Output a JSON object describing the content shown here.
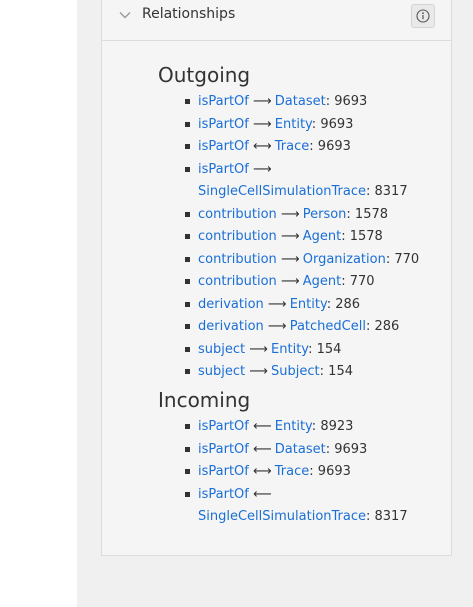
{
  "panel": {
    "title": "Relationships",
    "collapse_icon": "chevron-down-icon",
    "info_icon": "info-icon"
  },
  "outgoing": {
    "heading": "Outgoing",
    "items": [
      {
        "rel": "isPartOf",
        "arrow": "⟶",
        "target": "Dataset",
        "count": "9693"
      },
      {
        "rel": "isPartOf",
        "arrow": "⟶",
        "target": "Entity",
        "count": "9693"
      },
      {
        "rel": "isPartOf",
        "arrow": "⟷",
        "target": "Trace",
        "count": "9693"
      },
      {
        "rel": "isPartOf",
        "arrow": "⟶",
        "target": "SingleCellSimulationTrace",
        "count": "8317"
      },
      {
        "rel": "contribution",
        "arrow": "⟶",
        "target": "Person",
        "count": "1578"
      },
      {
        "rel": "contribution",
        "arrow": "⟶",
        "target": "Agent",
        "count": "1578"
      },
      {
        "rel": "contribution",
        "arrow": "⟶",
        "target": "Organization",
        "count": "770"
      },
      {
        "rel": "contribution",
        "arrow": "⟶",
        "target": "Agent",
        "count": "770"
      },
      {
        "rel": "derivation",
        "arrow": "⟶",
        "target": "Entity",
        "count": "286"
      },
      {
        "rel": "derivation",
        "arrow": "⟶",
        "target": "PatchedCell",
        "count": "286"
      },
      {
        "rel": "subject",
        "arrow": "⟶",
        "target": "Entity",
        "count": "154"
      },
      {
        "rel": "subject",
        "arrow": "⟶",
        "target": "Subject",
        "count": "154"
      }
    ]
  },
  "incoming": {
    "heading": "Incoming",
    "items": [
      {
        "rel": "isPartOf",
        "arrow": "⟵",
        "target": "Entity",
        "count": "8923"
      },
      {
        "rel": "isPartOf",
        "arrow": "⟵",
        "target": "Dataset",
        "count": "9693"
      },
      {
        "rel": "isPartOf",
        "arrow": "⟷",
        "target": "Trace",
        "count": "9693"
      },
      {
        "rel": "isPartOf",
        "arrow": "⟵",
        "target": "SingleCellSimulationTrace",
        "count": "8317"
      }
    ]
  }
}
